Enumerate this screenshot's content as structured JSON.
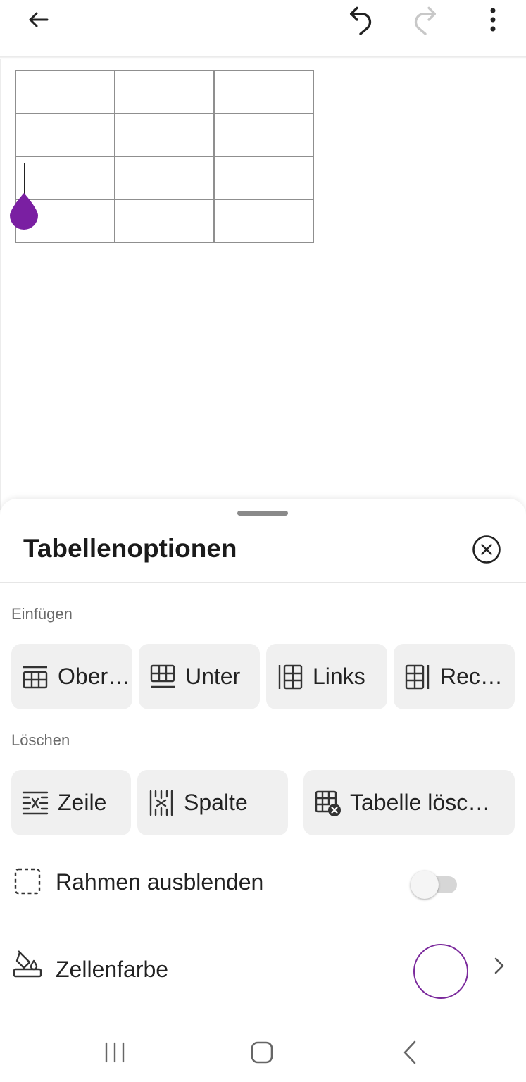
{
  "toolbar": {
    "back_icon": "arrow-left-icon",
    "undo_icon": "undo-icon",
    "redo_icon": "redo-icon",
    "more_icon": "more-vertical-icon",
    "redo_enabled": false
  },
  "document": {
    "table": {
      "rows": 4,
      "columns": 3
    },
    "cursor": {
      "row": 3,
      "column": 1,
      "handle_color": "#7a1fa2"
    }
  },
  "sheet": {
    "title": "Tabellenoptionen",
    "close_icon": "close-circle-icon",
    "insert": {
      "label": "Einfügen",
      "buttons": [
        {
          "label": "Ober…",
          "icon": "insert-row-above-icon"
        },
        {
          "label": "Unter",
          "icon": "insert-row-below-icon"
        },
        {
          "label": "Links",
          "icon": "insert-column-left-icon"
        },
        {
          "label": "Rec…",
          "icon": "insert-column-right-icon"
        }
      ]
    },
    "delete": {
      "label": "Löschen",
      "buttons": [
        {
          "label": "Zeile",
          "icon": "delete-row-icon"
        },
        {
          "label": "Spalte",
          "icon": "delete-column-icon"
        },
        {
          "label": "Tabelle lösc…",
          "icon": "delete-table-icon"
        }
      ]
    },
    "hide_borders": {
      "label": "Rahmen ausblenden",
      "icon": "dashed-border-icon",
      "enabled": false
    },
    "cell_color": {
      "label": "Zellenfarbe",
      "icon": "paint-bucket-icon",
      "value": "#ffffff",
      "ring_color": "#7b2a9c"
    }
  },
  "navbar": {
    "recents_icon": "recents-icon",
    "home_icon": "home-icon",
    "back_icon": "nav-back-icon"
  }
}
